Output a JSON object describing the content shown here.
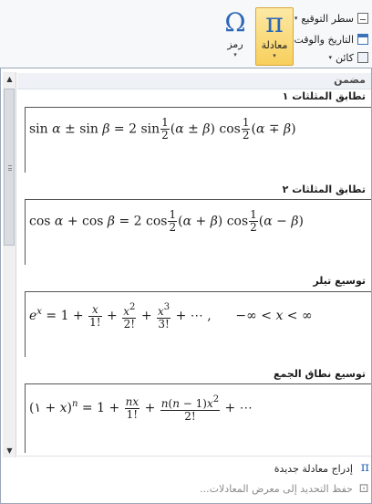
{
  "ribbon": {
    "signature_line": "سطر التوقيع",
    "date_time": "التاريخ والوقت",
    "object": "كائن",
    "symbol_glyph": "Ω",
    "symbol_label": "رمز",
    "equation_glyph": "π",
    "equation_label": "معادلة",
    "caret": "▾"
  },
  "gallery": {
    "header": "مضمن",
    "scroll_up": "▲",
    "scroll_down": "▼",
    "items": [
      {
        "category": "تطابق المثلثات ١"
      },
      {
        "category": "تطابق المثلثات ٢"
      },
      {
        "category": "توسيع تيلر"
      },
      {
        "category": "توسيع نطاق الجمع"
      }
    ],
    "insert_new": "إدراج معادلة جديدة",
    "save_selection": "حفظ التحديد إلى معرض المعادلات...",
    "footer_icon": "π"
  },
  "colors": {
    "accent": "#2b67b7",
    "selected_bg": "#f7cf5c"
  }
}
